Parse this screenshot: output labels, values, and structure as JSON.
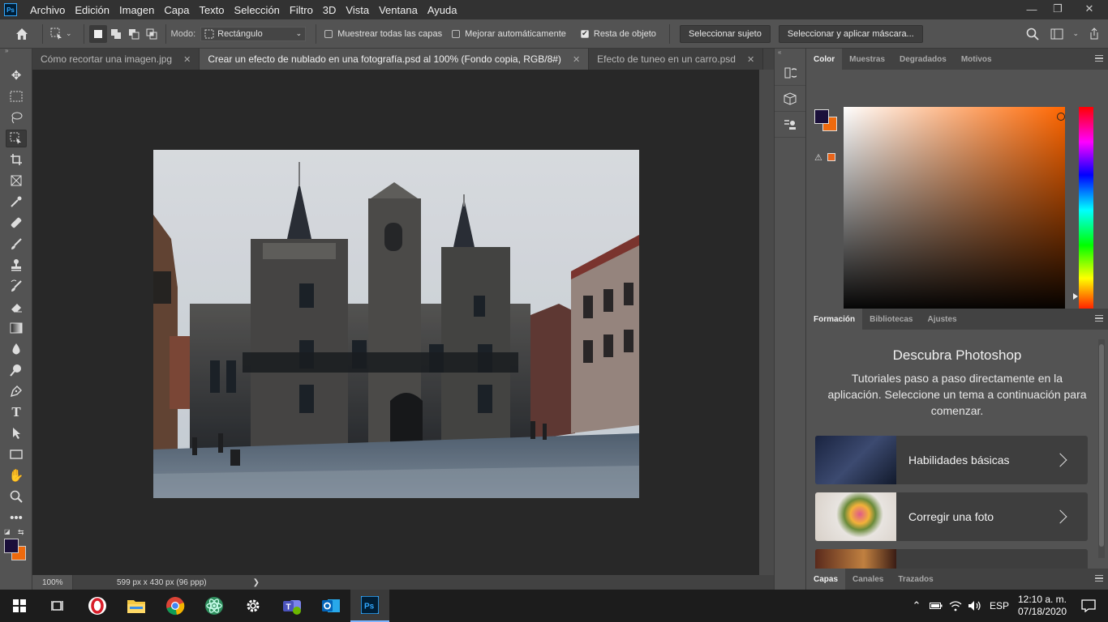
{
  "app": {
    "logo_text": "Ps",
    "menu": [
      "Archivo",
      "Edición",
      "Imagen",
      "Capa",
      "Texto",
      "Selección",
      "Filtro",
      "3D",
      "Vista",
      "Ventana",
      "Ayuda"
    ],
    "window_controls": {
      "minimize": "—",
      "restore": "❐",
      "close": "✕"
    }
  },
  "options_bar": {
    "mode_label": "Modo:",
    "mode_value": "Rectángulo",
    "sample_all_layers": {
      "label": "Muestrear todas las capas",
      "checked": false
    },
    "auto_enhance": {
      "label": "Mejorar automáticamente",
      "checked": false
    },
    "object_subtract": {
      "label": "Resta de objeto",
      "checked": true
    },
    "select_subject_label": "Seleccionar sujeto",
    "select_mask_label": "Seleccionar y aplicar máscara..."
  },
  "tabs": [
    {
      "title": "Cómo recortar una imagen.jpg",
      "active": false
    },
    {
      "title": "Crear un efecto de nublado en una fotografía.psd al 100% (Fondo copia, RGB/8#)",
      "active": true
    },
    {
      "title": "Efecto de tuneo en un carro.psd",
      "active": false
    }
  ],
  "tab_close": "✕",
  "status": {
    "zoom": "100%",
    "doc_info": "599 px x 430 px (96 ppp)",
    "arrow": "❯"
  },
  "colors": {
    "foreground": "#1a0f3a",
    "background": "#ef6a0d",
    "picker_hue": "#ff6600",
    "warning_swatch": "#e8641a",
    "accent": "#31a8ff"
  },
  "color_panel": {
    "tabs": [
      "Color",
      "Muestras",
      "Degradados",
      "Motivos"
    ],
    "warning_icon": "⚠"
  },
  "learn_panel": {
    "tabs": [
      "Formación",
      "Bibliotecas",
      "Ajustes"
    ],
    "title": "Descubra Photoshop",
    "subtitle": "Tutoriales paso a paso directamente en la aplicación. Seleccione un tema a continuación para comenzar.",
    "cards": [
      {
        "label": "Habilidades básicas"
      },
      {
        "label": "Corregir una foto"
      },
      {
        "label": ""
      }
    ]
  },
  "layers_panel": {
    "tabs": [
      "Capas",
      "Canales",
      "Trazados"
    ]
  },
  "taskbar": {
    "apps": [
      "start-icon",
      "task-view-icon",
      "opera-icon",
      "file-explorer-icon",
      "chrome-icon",
      "atom-icon",
      "settings-icon",
      "teams-icon",
      "outlook-icon",
      "photoshop-icon"
    ],
    "language": "ESP",
    "time": "12:10 a. m.",
    "date": "07/18/2020"
  }
}
